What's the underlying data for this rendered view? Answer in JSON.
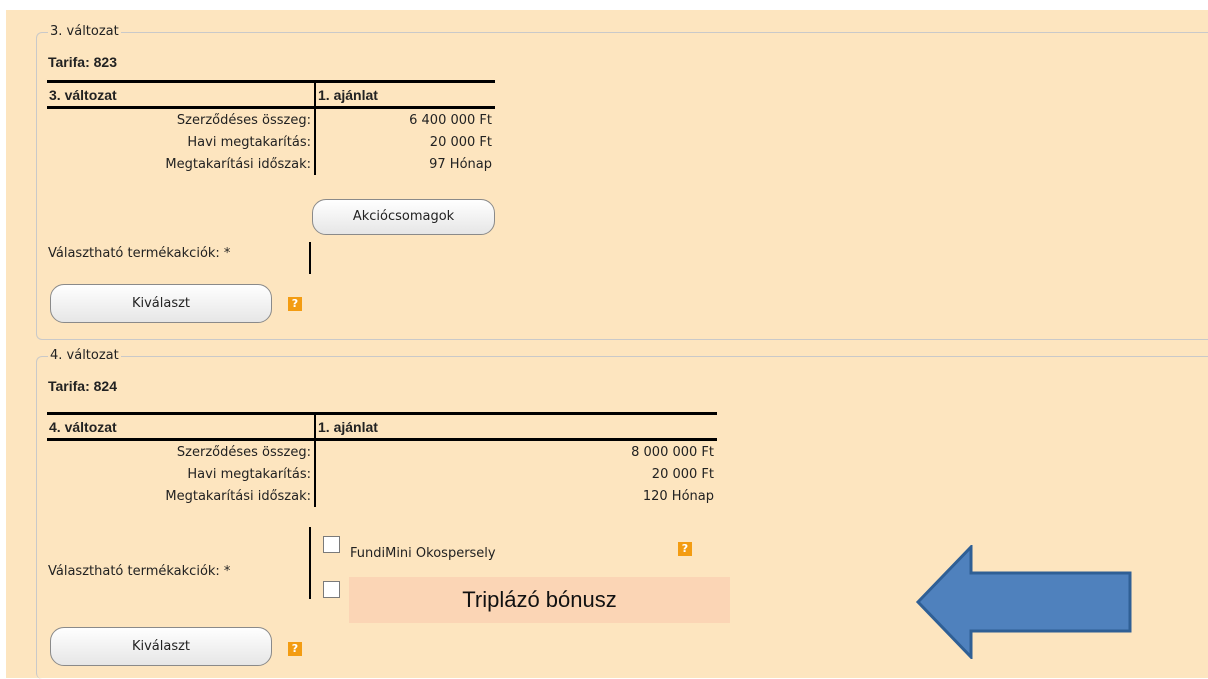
{
  "variant3": {
    "legend": "3. változat",
    "tarifa": "Tarifa: 823",
    "col1_header": "3. változat",
    "col2_header": "1. ajánlat",
    "rows": [
      {
        "label": "Szerződéses összeg:",
        "value": "6 400 000 Ft"
      },
      {
        "label": "Havi megtakarítás:",
        "value": "20 000 Ft"
      },
      {
        "label": "Megtakarítási időszak:",
        "value": "97 Hónap"
      }
    ],
    "action_packages_button": "Akciócsomagok",
    "product_actions_label": "Választható termékakciók: *",
    "select_button": "Kiválaszt",
    "help_icon": "?"
  },
  "variant4": {
    "legend": "4. változat",
    "tarifa": "Tarifa: 824",
    "col1_header": "4. változat",
    "col2_header": "1. ajánlat",
    "rows": [
      {
        "label": "Szerződéses összeg:",
        "value": "8 000 000 Ft"
      },
      {
        "label": "Havi megtakarítás:",
        "value": "20 000 Ft"
      },
      {
        "label": "Megtakarítási időszak:",
        "value": "120 Hónap"
      }
    ],
    "product_actions_label": "Választható termékakciók: *",
    "options": [
      {
        "label": "FundiMini Okospersely",
        "checked": false
      },
      {
        "label": "",
        "checked": false
      }
    ],
    "select_button": "Kiválaszt",
    "help_icon": "?"
  },
  "annotation": {
    "text": "Triplázó bónusz",
    "arrow_color": "#4f81bd",
    "arrow_icon": "left-arrow-icon"
  }
}
